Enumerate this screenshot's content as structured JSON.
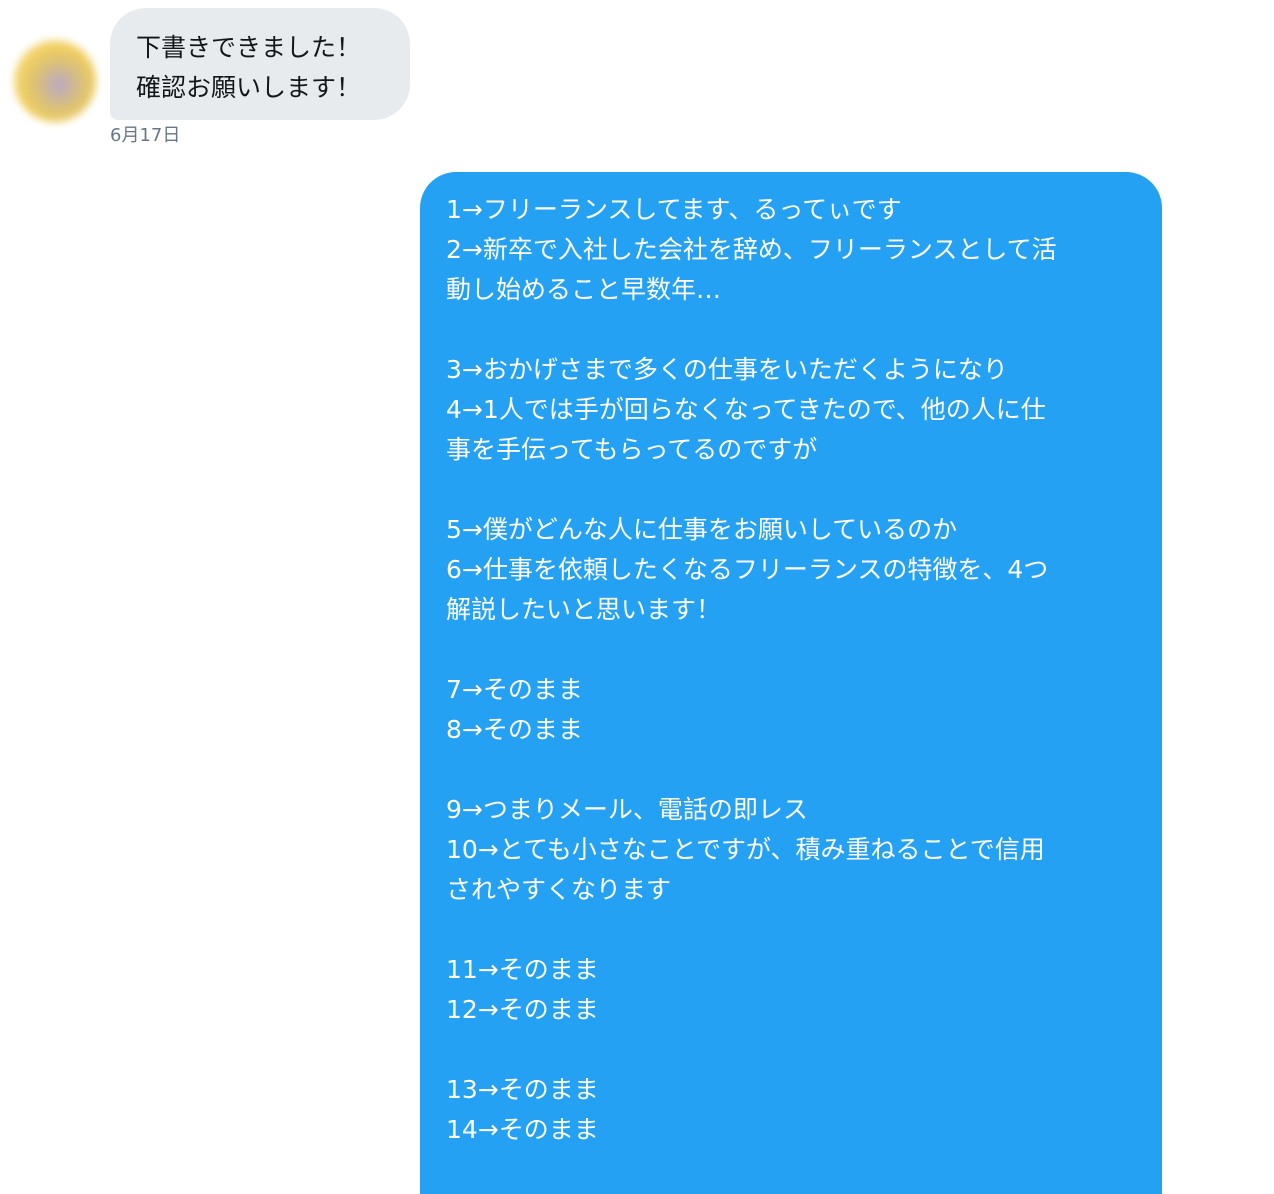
{
  "incoming": {
    "lines": [
      "下書きできました！",
      "確認お願いします！"
    ],
    "timestamp": "6月17日"
  },
  "outgoing": {
    "lines": [
      "1→フリーランスしてます、るってぃです",
      "2→新卒で入社した会社を辞め、フリーランスとして活",
      "動し始めること早数年…",
      "",
      "3→おかげさまで多くの仕事をいただくようになり",
      "4→1人では手が回らなくなってきたので、他の人に仕",
      "事を手伝ってもらってるのですが",
      "",
      "5→僕がどんな人に仕事をお願いしているのか",
      "6→仕事を依頼したくなるフリーランスの特徴を、4つ",
      "解説したいと思います！",
      "",
      "7→そのまま",
      "8→そのまま",
      "",
      "9→つまりメール、電話の即レス",
      "10→とても小さなことですが、積み重ねることで信用",
      "されやすくなります",
      "",
      "11→そのまま",
      "12→そのまま",
      "",
      "13→そのまま",
      "14→そのまま"
    ]
  },
  "colors": {
    "incoming_bubble": "#e7ebee",
    "outgoing_bubble": "#24a1f3",
    "timestamp": "#657786"
  }
}
